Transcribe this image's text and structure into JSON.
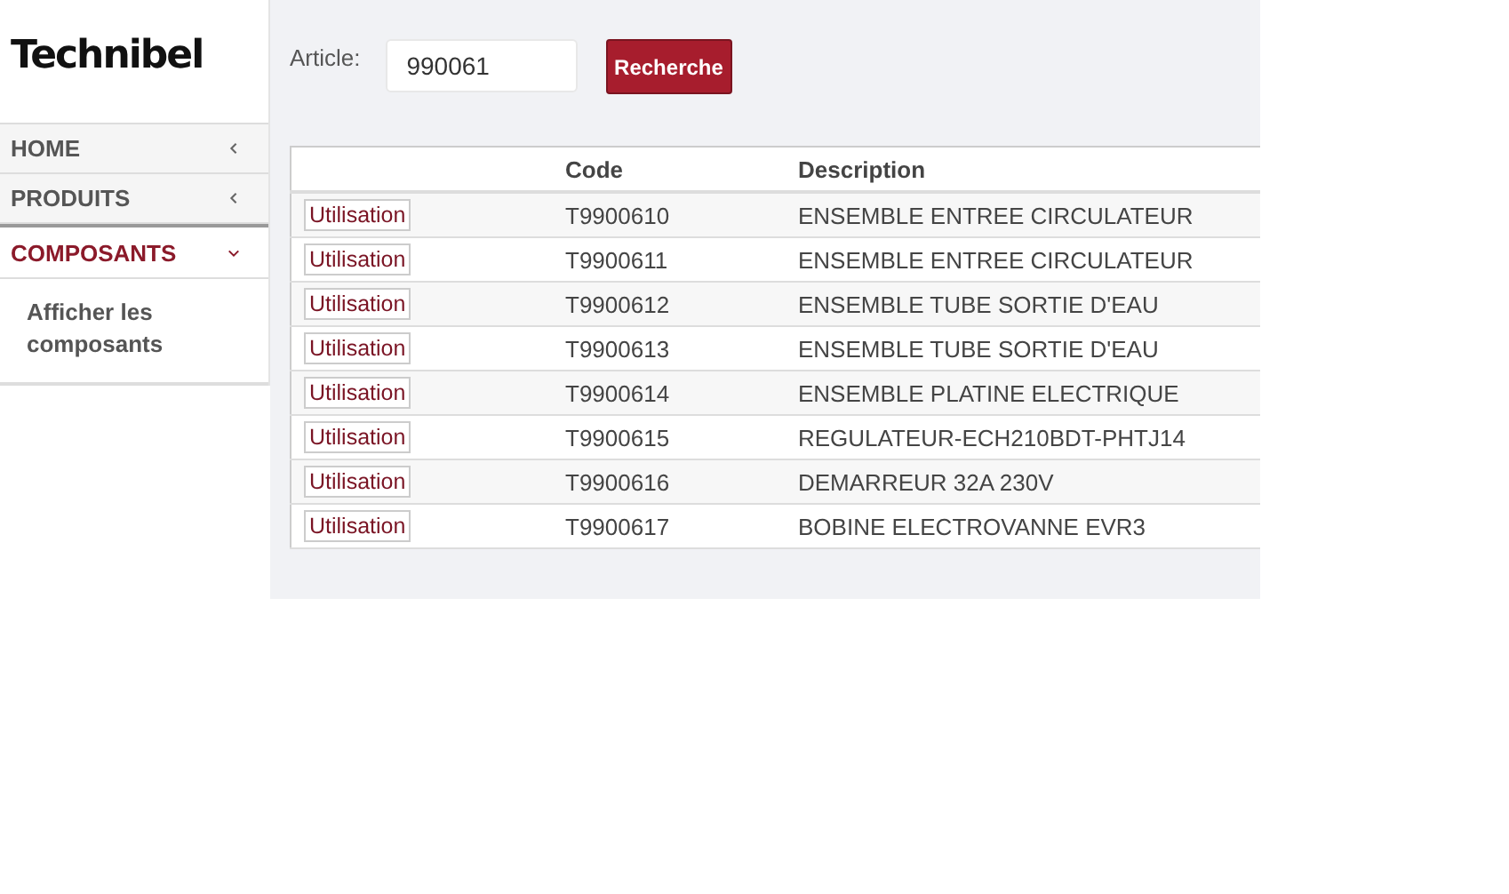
{
  "logo": "Technibel",
  "sidebar": {
    "items": [
      {
        "label": "HOME",
        "expanded": false
      },
      {
        "label": "PRODUITS",
        "expanded": false
      },
      {
        "label": "COMPOSANTS",
        "expanded": true,
        "children": [
          {
            "label": "Afficher les composants"
          }
        ]
      }
    ]
  },
  "search": {
    "label": "Article:",
    "value": "990061",
    "button": "Recherche"
  },
  "table": {
    "columns": [
      "",
      "Code",
      "Description"
    ],
    "rows": [
      {
        "action": "Utilisation",
        "code": "T9900610",
        "description": "ENSEMBLE ENTREE CIRCULATEUR"
      },
      {
        "action": "Utilisation",
        "code": "T9900611",
        "description": "ENSEMBLE ENTREE CIRCULATEUR"
      },
      {
        "action": "Utilisation",
        "code": "T9900612",
        "description": "ENSEMBLE TUBE SORTIE D'EAU"
      },
      {
        "action": "Utilisation",
        "code": "T9900613",
        "description": "ENSEMBLE TUBE SORTIE D'EAU"
      },
      {
        "action": "Utilisation",
        "code": "T9900614",
        "description": "ENSEMBLE PLATINE ELECTRIQUE"
      },
      {
        "action": "Utilisation",
        "code": "T9900615",
        "description": "REGULATEUR-ECH210BDT-PHTJ14"
      },
      {
        "action": "Utilisation",
        "code": "T9900616",
        "description": "DEMARREUR 32A 230V"
      },
      {
        "action": "Utilisation",
        "code": "T9900617",
        "description": "BOBINE ELECTROVANNE EVR3"
      }
    ]
  }
}
